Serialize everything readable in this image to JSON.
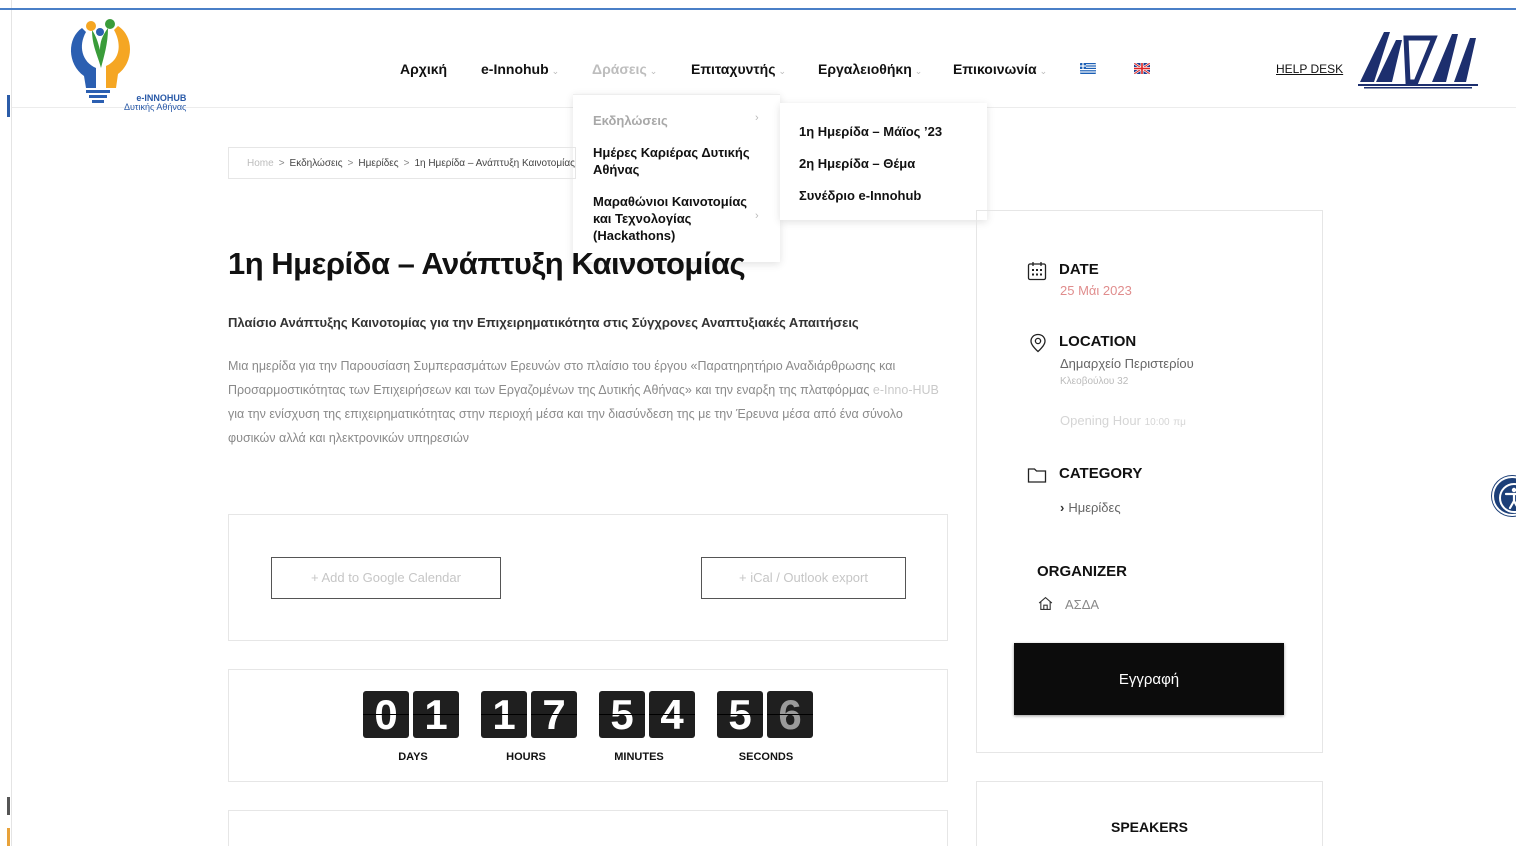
{
  "header": {
    "logo_line1": "e-INNOHUB",
    "logo_line2": "Δυτικής Αθήνας",
    "nav": [
      {
        "label": "Αρχική"
      },
      {
        "label": "e-Innohub"
      },
      {
        "label": "Δράσεις"
      },
      {
        "label": "Επιταχυντής"
      },
      {
        "label": "Εργαλειοθήκη"
      },
      {
        "label": "Επικοινωνία"
      }
    ],
    "flags": [
      "greek-flag-icon",
      "uk-flag-icon"
    ],
    "helpdesk": "HELP DESK",
    "partner_logo": "ΑΣΔΑ"
  },
  "dropdown": {
    "items": [
      {
        "label": "Εκδηλώσεις"
      },
      {
        "label": "Ημέρες Καριέρας Δυτικής Αθήνας"
      },
      {
        "label": "Μαραθώνιοι Καινοτομίας και Τεχνολογίας (Hackathons)"
      }
    ],
    "submenu": [
      {
        "label": "1η Ημερίδα – Μάϊος ’23"
      },
      {
        "label": "2η Ημερίδα – Θέμα"
      },
      {
        "label": "Συνέδριο e-Innohub"
      }
    ]
  },
  "breadcrumb": {
    "home": "Home",
    "items": [
      "Εκδηλώσεις",
      "Ημερίδες",
      "1η Ημερίδα – Ανάπτυξη Καινοτομίας"
    ]
  },
  "event": {
    "title": "1η Ημερίδα – Ανάπτυξη Καινοτομίας",
    "subtitle": "Πλαίσιο Ανάπτυξης Καινοτομίας για την Επιχειρηματικότητα στις Σύγχρονες Αναπτυξιακές Απαιτήσεις",
    "desc_part1": "Μια ημερίδα για την Παρουσίαση Συμπερασμάτων Ερευνών στο πλαίσιο του έργου «Παρατηρητήριο Αναδιάρθρωσης και Προσαρμοστικότητας των Επιχειρήσεων και των Εργαζομένων της Δυτικής Αθήνας» και την εναρξη της πλατφόρμας ",
    "desc_link": "e-Inno-HUB",
    "desc_part2": " για την ενίσχυση της επιχειρηματικότητας στην περιοχή μέσα και την διασύνδεση της με την Έρευνα μέσα από ένα σύνολο φυσικών αλλά και ηλεκτρονικών υπηρεσιών"
  },
  "buttons": {
    "google": "+ Add to Google Calendar",
    "ical": "+ iCal / Outlook export",
    "register": "Εγγραφή"
  },
  "countdown": {
    "days": "01",
    "hours": "17",
    "minutes": "54",
    "seconds": "56",
    "labels": [
      "DAYS",
      "HOURS",
      "MINUTES",
      "SECONDS"
    ]
  },
  "sidebar": {
    "date_label": "DATE",
    "date_value": "25 Μάι 2023",
    "location_label": "LOCATION",
    "location_name": "Δημαρχείο Περιστερίου",
    "location_address": "Κλεοβούλου 32",
    "opening_label": "Opening Hour",
    "opening_time": "10:00",
    "opening_suffix": "πμ",
    "category_label": "CATEGORY",
    "category_value": "Ημερίδες",
    "organizer_label": "ORGANIZER",
    "organizer_value": "ΑΣΔΑ",
    "speakers_label": "SPEAKERS"
  },
  "colors": {
    "accent_link": "#c9c9c9",
    "date_red": "#e08d8d",
    "header_blue": "#2a5aa8"
  }
}
